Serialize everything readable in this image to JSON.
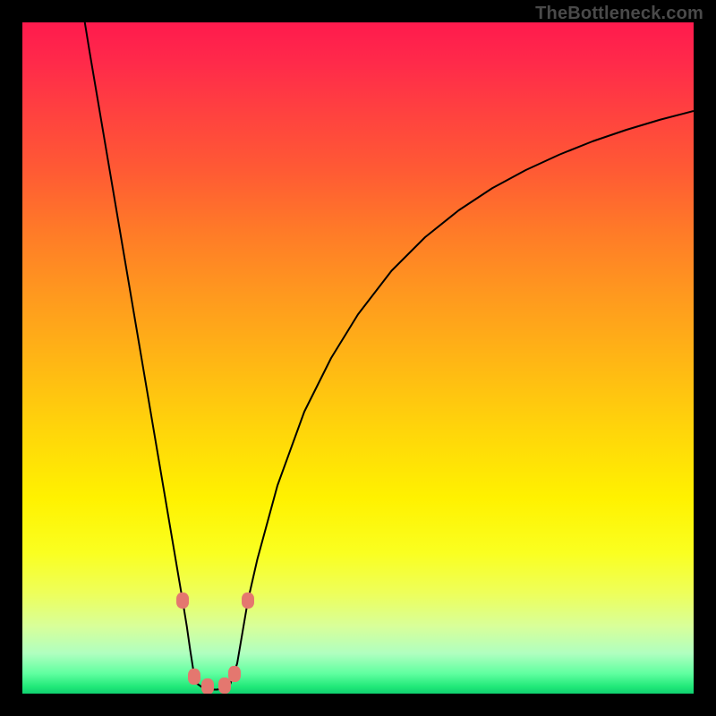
{
  "watermark": "TheBottleneck.com",
  "colors": {
    "frame": "#000000",
    "curve": "#000000",
    "marker_fill": "#e4776f",
    "marker_stroke": "#d45a52"
  },
  "chart_data": {
    "type": "line",
    "title": "",
    "xlabel": "",
    "ylabel": "",
    "xlim": [
      0,
      100
    ],
    "ylim": [
      0,
      100
    ],
    "grid": false,
    "legend": false,
    "note": "Bottleneck-style V-curve. y ≈ 100 while rising (red), ≈ 0 at green floor. Minimum near x ≈ 26.",
    "series": [
      {
        "name": "left-branch",
        "x": [
          9.3,
          10,
          12,
          14,
          16,
          18,
          20,
          21,
          22,
          23,
          23.87,
          24.5,
          25,
          25.5,
          26
        ],
        "values": [
          100,
          95.7,
          83.9,
          72.1,
          60.3,
          48.5,
          36.7,
          30.8,
          24.9,
          19,
          13.87,
          10,
          6.5,
          3.3,
          1.5
        ]
      },
      {
        "name": "floor",
        "x": [
          26,
          27,
          28,
          29,
          30,
          31
        ],
        "values": [
          1.5,
          0.8,
          0.6,
          0.6,
          0.8,
          1.5
        ]
      },
      {
        "name": "right-branch",
        "x": [
          31,
          32,
          33.6,
          35,
          38,
          42,
          46,
          50,
          55,
          60,
          65,
          70,
          75,
          80,
          85,
          90,
          95,
          100
        ],
        "values": [
          1.5,
          4.5,
          13.87,
          20,
          31,
          42,
          50,
          56.5,
          63,
          68,
          72,
          75.3,
          78,
          80.3,
          82.3,
          84,
          85.5,
          86.8
        ]
      }
    ],
    "markers": {
      "name": "highlighted-points",
      "x": [
        23.87,
        25.6,
        27.6,
        30.13,
        31.6,
        33.6
      ],
      "values": [
        13.87,
        2.53,
        1.07,
        1.2,
        2.93,
        13.87
      ]
    }
  }
}
